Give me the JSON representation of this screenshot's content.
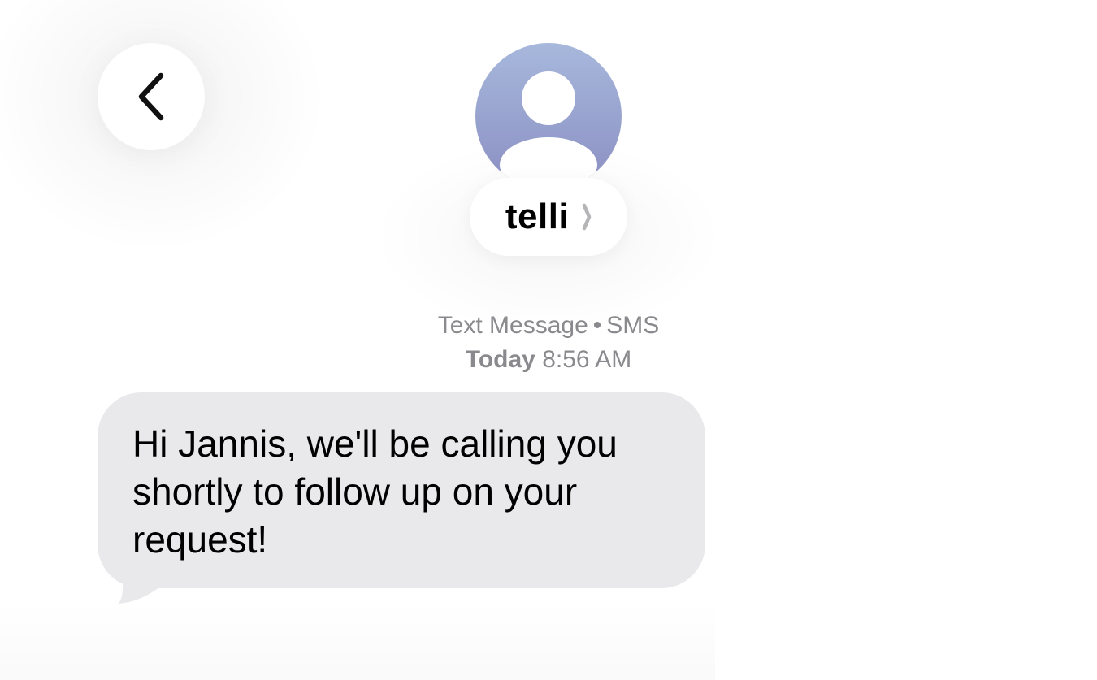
{
  "header": {
    "back_icon": "chevron-left-icon",
    "contact": {
      "name": "telli",
      "avatar_icon": "person-placeholder-icon",
      "chevron_icon": "chevron-right-icon"
    }
  },
  "thread": {
    "service_label": "Text Message",
    "separator": "•",
    "service_type": "SMS",
    "day_label": "Today",
    "time": "8:56 AM",
    "messages": [
      {
        "direction": "incoming",
        "text": "Hi Jannis, we'll be calling you shortly to follow up on your request!"
      }
    ]
  },
  "colors": {
    "bubble_incoming": "#e9e9eb",
    "meta_text": "#8a8a8e",
    "avatar_gradient_top": "#a7b8dc",
    "avatar_gradient_bottom": "#8a8fc2"
  }
}
